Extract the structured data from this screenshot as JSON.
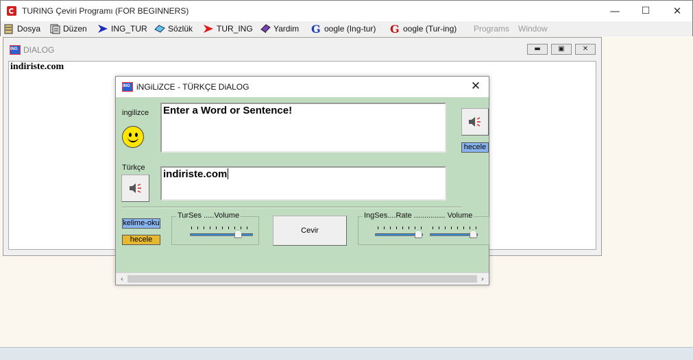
{
  "app": {
    "title": "TURING Çeviri Programı (FOR BEGINNERS)"
  },
  "window_controls": {
    "minimize": "—",
    "maximize": "☐",
    "close": "✕"
  },
  "menu": {
    "dosya": "Dosya",
    "duzen": "Düzen",
    "ing_tur": "ING_TUR",
    "sozluk": "Sözlük",
    "tur_ing": "TUR_ING",
    "yardim": "Yardim",
    "google_ing_tur": "oogle (Ing-tur)",
    "google_tur_ing": "oogle (Tur-ing)",
    "programs": "Programs",
    "window": "Window"
  },
  "mdi": {
    "title": "DIALOG",
    "content": "indiriste.com"
  },
  "dialog": {
    "title": "iNGiLiZCE - TÜRKÇE DiALOG",
    "english_label": "ingilizce",
    "english_text": "Enter a Word or Sentence!",
    "turkish_label": "Türkçe",
    "turkish_text": "indiriste.com",
    "hecele_top": "hecele",
    "kelime_oku": "kelime-oku",
    "hecele_bottom": "hecele",
    "tur_group_label": "TurSes .....Volume",
    "ing_group_label": "IngSes....Rate ............... Volume",
    "cevir": "Cevir",
    "tur_volume": 0.75,
    "ing_rate": 0.9,
    "ing_volume": 0.9
  },
  "colors": {
    "dialog_bg": "#c0dcc0",
    "hecele_blue": "#8ab4f0",
    "hecele_gold": "#e6b830",
    "kelime_blue": "#8ab4f0"
  }
}
